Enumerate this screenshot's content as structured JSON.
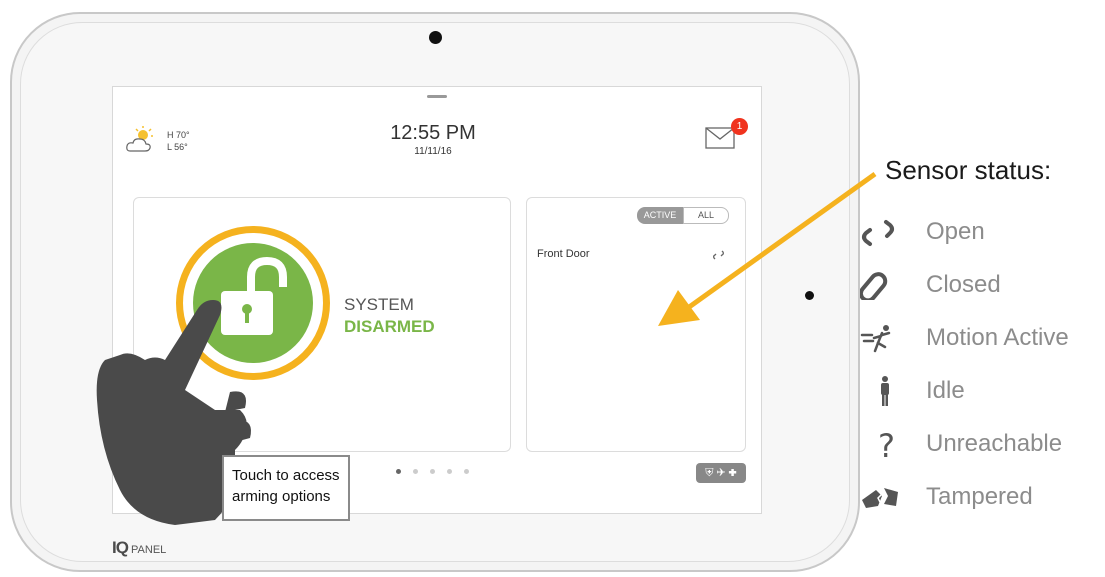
{
  "panel": {
    "brand_main": "IQ",
    "brand_sub": "PANEL"
  },
  "header": {
    "temp_high": "H 70°",
    "temp_low": "L 56°",
    "weather_icon": "partly-cloudy-icon",
    "time": "12:55 PM",
    "date": "11/11/16",
    "mail_icon": "envelope-icon",
    "mail_badge": "1"
  },
  "arming": {
    "status_line1": "SYSTEM",
    "status_line2": "DISARMED",
    "lock_icon": "unlocked-padlock-icon",
    "ring_color": "#f5b21e",
    "status_color": "#7ab648"
  },
  "sensors": {
    "tab_active": "ACTIVE",
    "tab_all": "ALL",
    "rows": [
      {
        "name": "Front Door",
        "icon": "open-link-icon"
      }
    ]
  },
  "pager": {
    "count": 5,
    "current": 1
  },
  "emergency": {
    "label": "⛨ ✈ ✚",
    "icon": "emergency-icons"
  },
  "callout": {
    "text": "Touch to access arming options"
  },
  "legend": {
    "title": "Sensor status:",
    "items": [
      {
        "label": "Open",
        "icon": "open-link-icon"
      },
      {
        "label": "Closed",
        "icon": "closed-link-icon"
      },
      {
        "label": "Motion Active",
        "icon": "running-person-icon"
      },
      {
        "label": "Idle",
        "icon": "standing-person-icon"
      },
      {
        "label": "Unreachable",
        "icon": "question-mark-icon"
      },
      {
        "label": "Tampered",
        "icon": "broken-device-icon"
      }
    ]
  },
  "colors": {
    "arrow": "#f5b21e",
    "icon_gray": "#555555"
  }
}
